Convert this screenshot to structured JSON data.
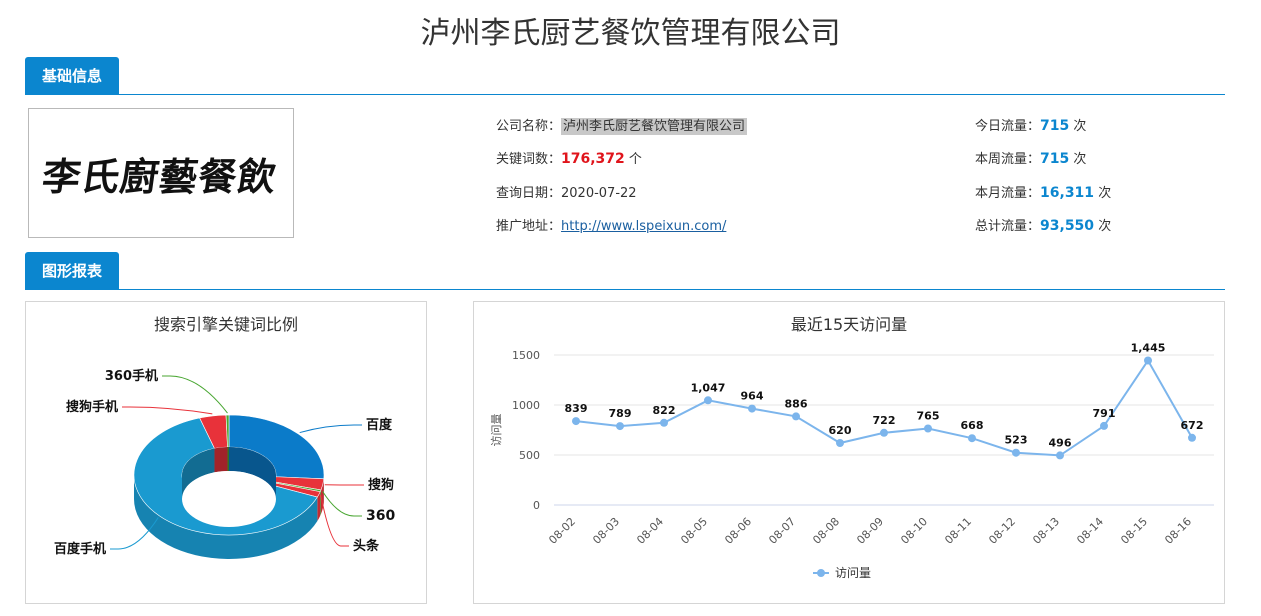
{
  "page": {
    "title": "泸州李氏厨艺餐饮管理有限公司"
  },
  "sections": {
    "basic": "基础信息",
    "charts": "图形报表"
  },
  "logo": {
    "text": "李氏廚藝餐飲"
  },
  "info": {
    "company_label": "公司名称：",
    "company_value": "泸州李氏厨艺餐饮管理有限公司",
    "keywords_label": "关键词数：",
    "keywords_value": "176,372",
    "keywords_unit": "个",
    "date_label": "查询日期：",
    "date_value": "2020-07-22",
    "url_label": "推广地址：",
    "url_value": "http://www.lspeixun.com/"
  },
  "traffic": {
    "today_label": "今日流量：",
    "today_value": "715",
    "today_unit": "次",
    "week_label": "本周流量：",
    "week_value": "715",
    "week_unit": "次",
    "month_label": "本月流量：",
    "month_value": "16,311",
    "month_unit": "次",
    "total_label": "总计流量：",
    "total_value": "93,550",
    "total_unit": "次"
  },
  "chart_data": [
    {
      "type": "pie",
      "title": "搜索引擎关键词比例",
      "donut": true,
      "labels": [
        "百度",
        "搜狗",
        "360",
        "头条",
        "百度手机",
        "搜狗手机",
        "360手机"
      ],
      "values": [
        26,
        3,
        0.5,
        1.5,
        64,
        4.5,
        0.5
      ],
      "colors": [
        "#0b7bc9",
        "#e8323a",
        "#48a631",
        "#e8323a",
        "#1a9ad0",
        "#e8323a",
        "#48a631"
      ]
    },
    {
      "type": "line",
      "title": "最近15天访问量",
      "x": [
        "08-02",
        "08-03",
        "08-04",
        "08-05",
        "08-06",
        "08-07",
        "08-08",
        "08-09",
        "08-10",
        "08-11",
        "08-12",
        "08-13",
        "08-14",
        "08-15",
        "08-16"
      ],
      "series": [
        {
          "name": "访问量",
          "values": [
            839,
            789,
            822,
            1047,
            964,
            886,
            620,
            722,
            765,
            668,
            523,
            496,
            791,
            1445,
            672
          ]
        }
      ],
      "ylabel": "访问量",
      "ylim": [
        0,
        1500
      ],
      "yticks": [
        0,
        500,
        1000,
        1500
      ],
      "grid": true,
      "legend": "bottom",
      "color": "#7cb5ec"
    }
  ]
}
